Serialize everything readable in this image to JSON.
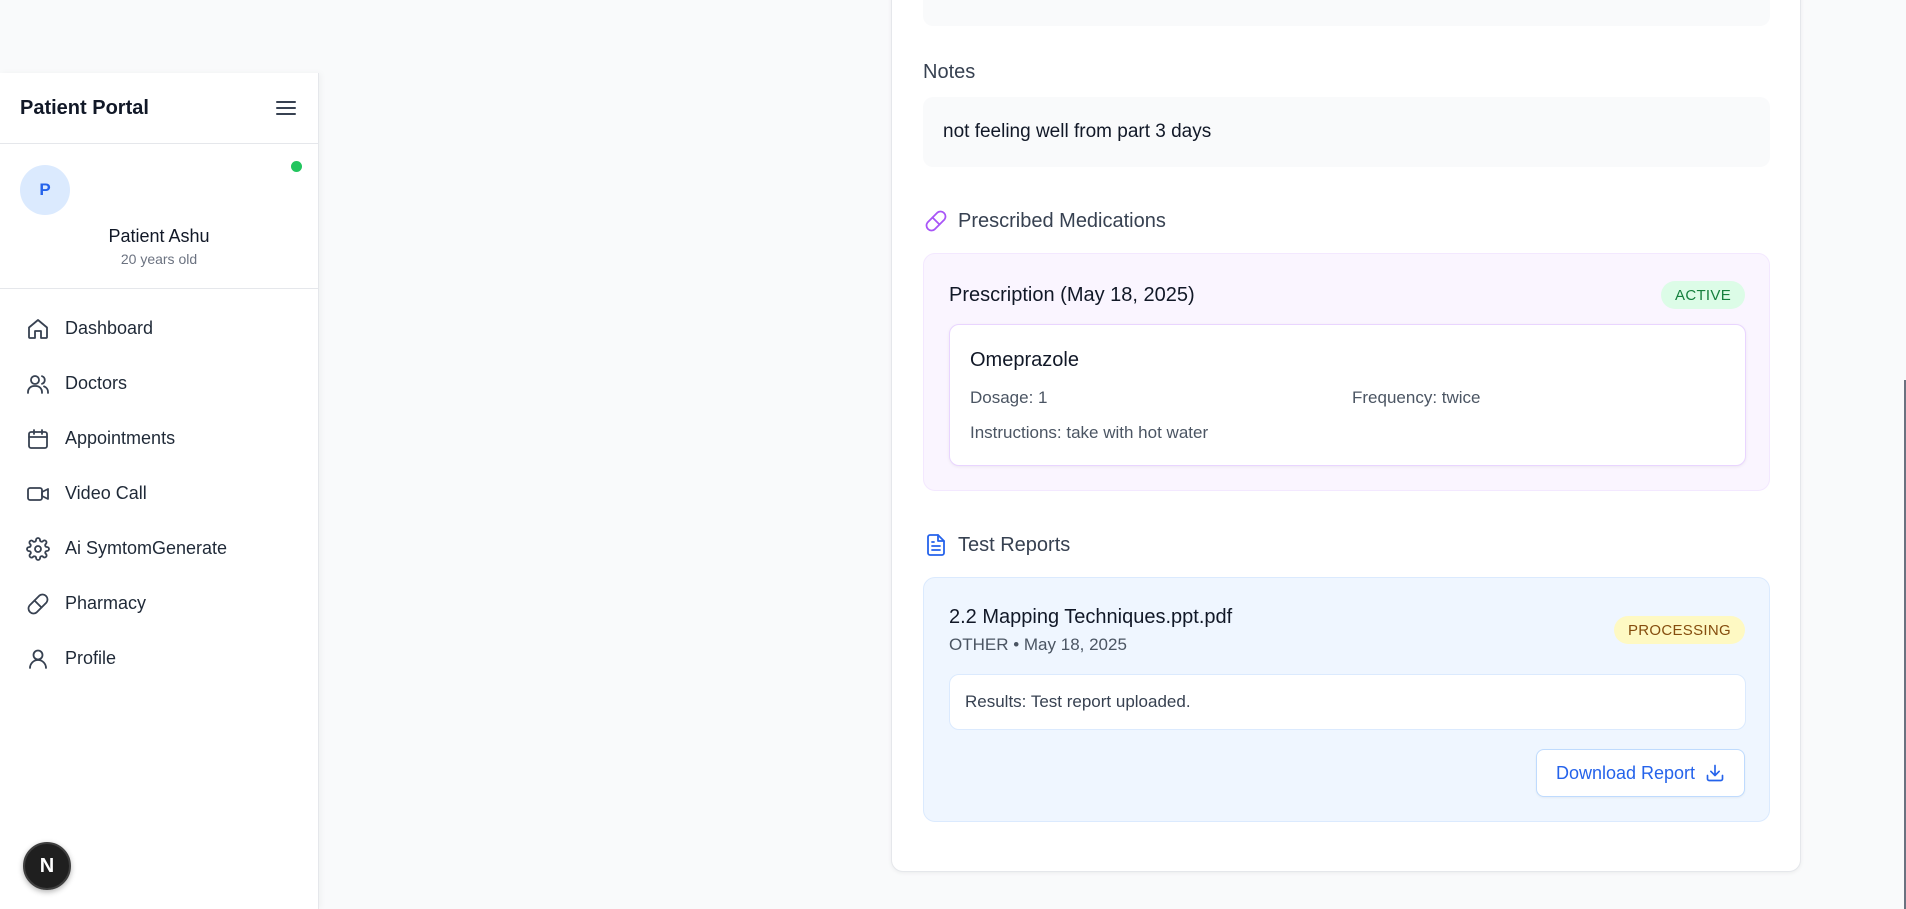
{
  "sidebar": {
    "title": "Patient Portal",
    "profile": {
      "avatar_initial": "P",
      "name": "Patient Ashu",
      "age": "20 years old",
      "status_color": "#22c55e"
    },
    "nav": [
      {
        "label": "Dashboard",
        "icon": "home-icon"
      },
      {
        "label": "Doctors",
        "icon": "users-icon"
      },
      {
        "label": "Appointments",
        "icon": "calendar-icon"
      },
      {
        "label": "Video Call",
        "icon": "video-icon"
      },
      {
        "label": "Ai SymtomGenerate",
        "icon": "gear-icon"
      },
      {
        "label": "Pharmacy",
        "icon": "pill-icon"
      },
      {
        "label": "Profile",
        "icon": "user-icon"
      }
    ]
  },
  "dev_badge": {
    "label": "N"
  },
  "main": {
    "notes": {
      "label": "Notes",
      "text": "not feeling well from part 3 days"
    },
    "medications": {
      "heading": "Prescribed Medications",
      "prescription": {
        "title": "Prescription (May 18, 2025)",
        "status": "ACTIVE",
        "medicine": {
          "name": "Omeprazole",
          "dosage": "Dosage: 1",
          "frequency": "Frequency: twice",
          "instructions": "Instructions: take with hot water"
        }
      }
    },
    "reports": {
      "heading": "Test Reports",
      "report": {
        "file_name": "2.2 Mapping Techniques.ppt.pdf",
        "meta": "OTHER • May 18, 2025",
        "status": "PROCESSING",
        "results": "Results: Test report uploaded.",
        "download_label": "Download Report"
      }
    }
  },
  "colors": {
    "accent_blue": "#2563eb",
    "active_badge_bg": "#dcfce7",
    "processing_badge_bg": "#fef9c3",
    "medication_icon": "#a855f7"
  }
}
